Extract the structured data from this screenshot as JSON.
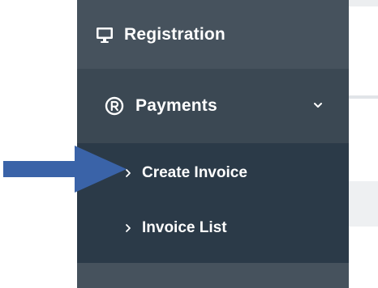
{
  "sidebar": {
    "registration": {
      "label": "Registration",
      "icon": "monitor-icon"
    },
    "payments": {
      "label": "Payments",
      "icon": "registered-icon",
      "expanded": true,
      "submenu": [
        {
          "label": "Create Invoice",
          "icon": "chevron-right-icon"
        },
        {
          "label": "Invoice List",
          "icon": "chevron-right-icon"
        }
      ]
    }
  },
  "annotation": {
    "arrow_color": "#3a63a8",
    "points_to": "Create Invoice"
  },
  "colors": {
    "sidebar_bg": "#3e4b57",
    "submenu_bg": "#2b3a48",
    "text": "#ffffff"
  }
}
